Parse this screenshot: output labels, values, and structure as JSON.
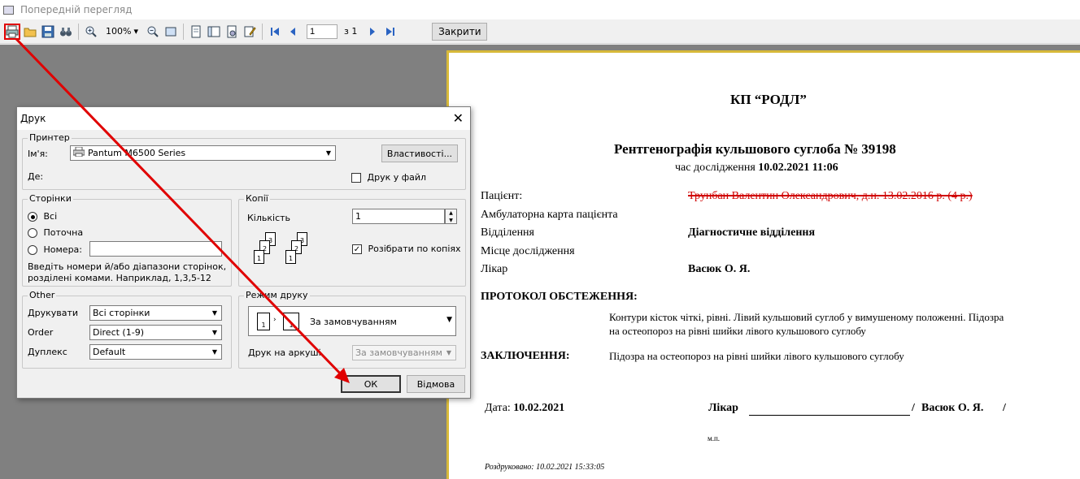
{
  "window": {
    "title": "Попередній перегляд"
  },
  "toolbar": {
    "zoom": "100%",
    "page_current": "1",
    "page_of": "з 1",
    "close_label": "Закрити"
  },
  "document": {
    "org": "КП “РОДЛ”",
    "title": "Рентгенографія кульшового суглоба № 39198",
    "exam_time_label": "час дослідження",
    "exam_time_value": "10.02.2021 11:06",
    "patient_label": "Пацієнт:",
    "patient_value": "Трунбан Валентин Олександрович, д.н. 13.02.2016 р. (4 р.)",
    "card_label": "Амбулаторна карта пацієнта",
    "dept_label": "Відділення",
    "dept_value": "Діагностичне відділення",
    "place_label": "Місце дослідження",
    "doctor_label": "Лікар",
    "doctor_value": "Васюк  О. Я.",
    "protocol_label": "ПРОТОКОЛ  ОБСТЕЖЕННЯ:",
    "protocol_text_1": "Контури кісток чіткі, рівні. Лівий кульшовий суглоб у вимушеному положенні. Підозра",
    "protocol_text_2": "на остеопороз на рівні шийки лівого кульшового суглобу",
    "conclusion_label": "ЗАКЛЮЧЕННЯ:",
    "conclusion_text": "Підозра на остеопороз на рівні шийки лівого кульшового суглобу",
    "date_label": "Дата:",
    "date_value": "10.02.2021",
    "sign_doctor_label": "Лікар",
    "sign_doctor_value": "Васюк  О. Я.",
    "sign_slash_1": "/",
    "sign_slash_2": "/",
    "mp": "м.п.",
    "printed_label": "Роздруковано:",
    "printed_value": "10.02.2021 15:33:05"
  },
  "dialog": {
    "title": "Друк",
    "printer_group": "Принтер",
    "name_label": "Ім'я:",
    "printer_name": "Pantum M6500 Series",
    "properties_button": "Властивості...",
    "where_label": "Де:",
    "print_to_file": "Друк у файл",
    "pages_group": "Сторінки",
    "pages_all": "Всі",
    "pages_current": "Поточна",
    "pages_numbers": "Номера:",
    "pages_hint_1": "Введіть номери й/або діапазони сторінок,",
    "pages_hint_2": "розділені комами. Наприклад, 1,3,5-12",
    "copies_group": "Копії",
    "copies_label": "Кількість",
    "copies_value": "1",
    "collate_label": "Розібрати по копіях",
    "other_group": "Other",
    "print_label": "Друкувати",
    "print_value": "Всі сторінки",
    "order_label": "Order",
    "order_value": "Direct (1-9)",
    "duplex_label": "Дуплекс",
    "duplex_value": "Default",
    "mode_group": "Режим друку",
    "mode_value": "За замовчуванням",
    "sheet_label": "Друк на аркуші",
    "sheet_value": "За замовчуванням",
    "ok": "ОК",
    "cancel": "Відмова"
  },
  "colors": {
    "annotation": "#e00000",
    "accent_border": "#d7b93a"
  }
}
